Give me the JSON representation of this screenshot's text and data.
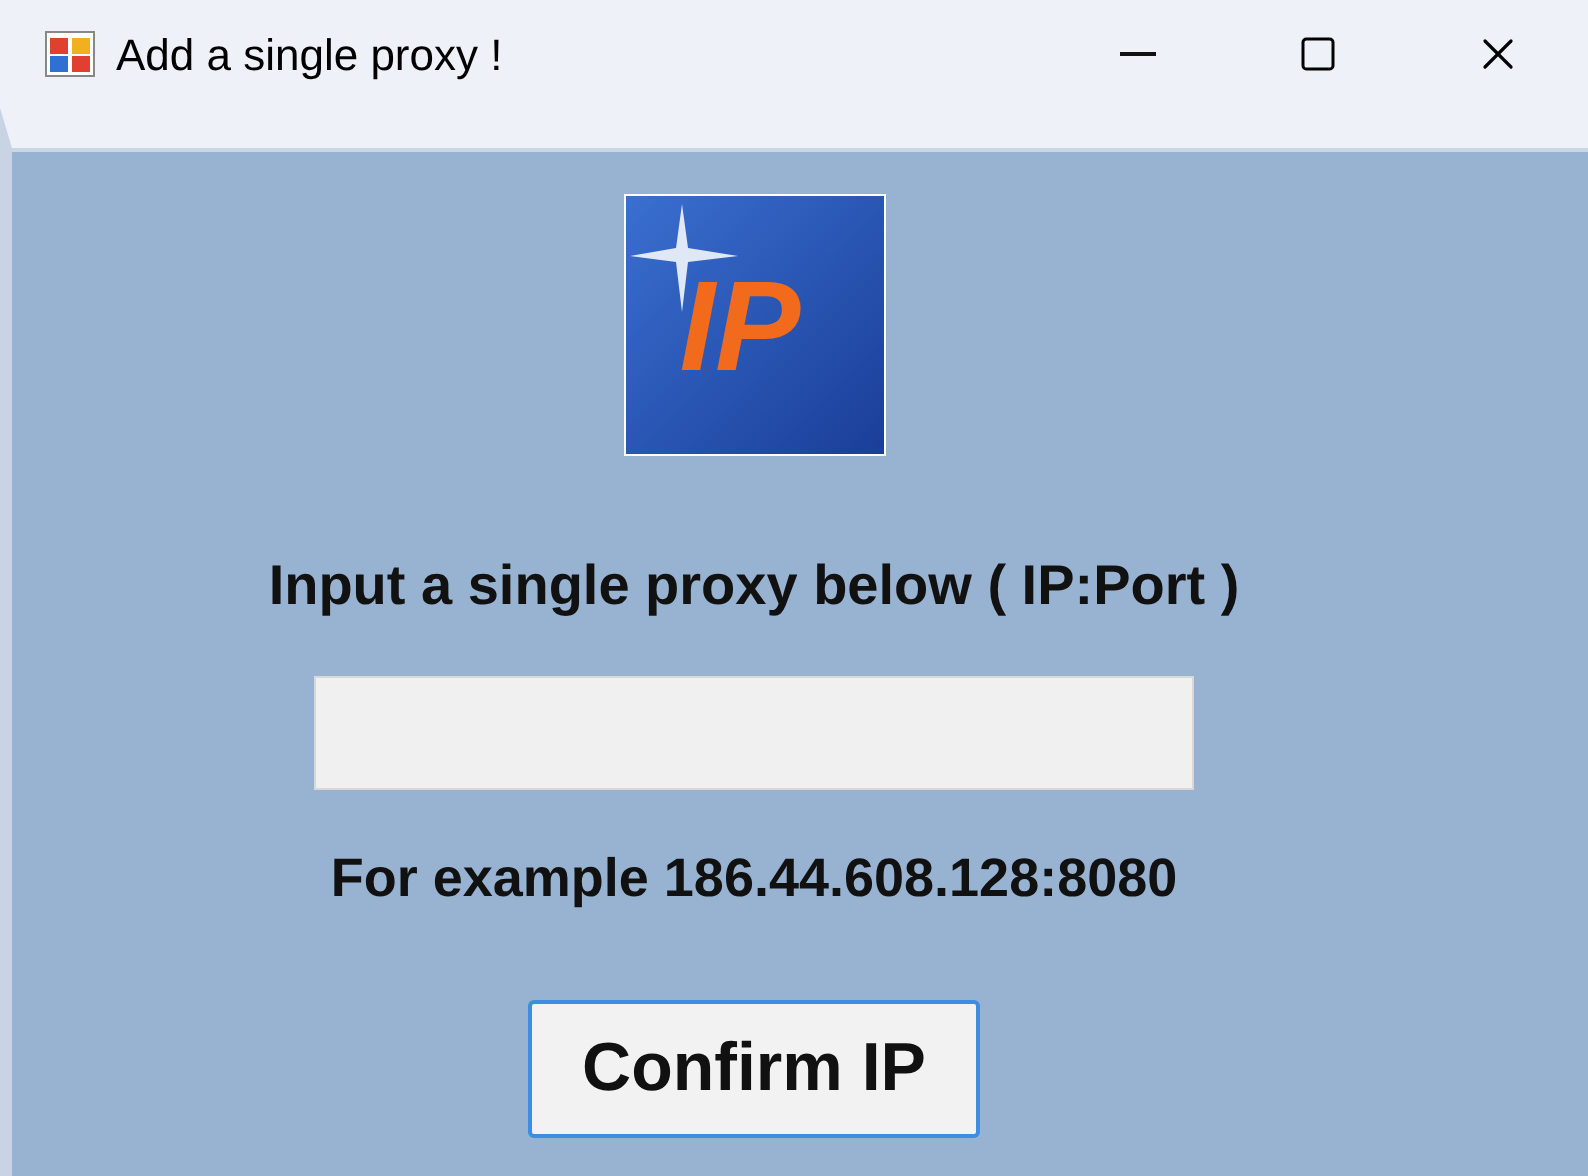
{
  "window": {
    "title": "Add a single proxy !"
  },
  "logo": {
    "text": "IP"
  },
  "prompt": "Input a single proxy below ( IP:Port )",
  "example": "For example 186.44.608.128:8080",
  "buttons": [
    "Confirm IP"
  ]
}
